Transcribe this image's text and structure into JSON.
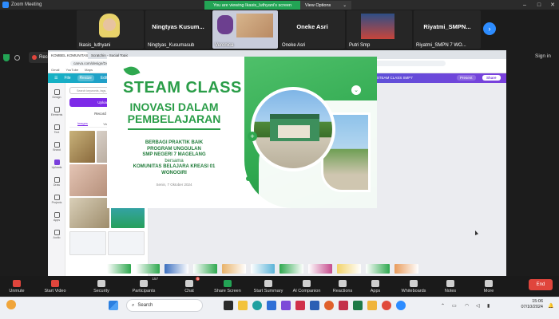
{
  "zoom": {
    "window_title": "Zoom Meeting",
    "banner_viewing": "You are viewing Ikasis_luthyani's screen",
    "banner_view_options": "View Options",
    "window_controls": [
      "–",
      "□",
      "✕"
    ]
  },
  "participants": [
    {
      "name": "Ikasis_luthyani",
      "type": "video"
    },
    {
      "name": "Ningtyas_Kusumasub",
      "title": "Ningtyas  Kusum...",
      "type": "name"
    },
    {
      "name": "Veronica",
      "type": "video"
    },
    {
      "name": "Oneke Asri",
      "title": "Oneke Asri",
      "type": "name"
    },
    {
      "name": "Putri Smp",
      "type": "video"
    },
    {
      "name": "Riyatmi_SMPN 7 WO...",
      "title": "Riyatmi_SMPN...",
      "type": "name"
    }
  ],
  "recording": {
    "label": "Recording...",
    "pause": "II",
    "stop": "■"
  },
  "sign_in": "Sign in",
  "browser": {
    "tabs": [
      "KOMBEL KOMUNITAS WDS...",
      "Scratchin - Social Topic"
    ],
    "url": "canva.com/design/DAGSbVHRV/Q4VMb7d9ZeJB-a6kx5d07Vb/edit",
    "bookmarks": [
      "Gmail",
      "YouTube",
      "Maps"
    ]
  },
  "canva": {
    "menu": [
      "File",
      "Resize",
      "Editing"
    ],
    "doc_title": "KOMBEL WORKSHOP STEAM CLASS SMP7",
    "present": "Present",
    "share": "Share",
    "rail": [
      "Design",
      "Elements",
      "Text",
      "Brand",
      "Uploads",
      "Draw",
      "Projects",
      "Apps",
      "Audio"
    ],
    "search_placeholder": "Search keywords, tags, color, and...",
    "upload_button": "Upload files",
    "record_yourself": "Record yourself",
    "upload_tabs": [
      "Images",
      "Videos",
      "Audio"
    ],
    "active_upload_tab": "Images"
  },
  "slide": {
    "title": "STEAM CLASS",
    "subtitle": "INOVASI DALAM PEMBELAJARAN",
    "body_lines": [
      "BERBAGI PRAKTIK BAIK",
      "PROGRAM UNGGULAN",
      "SMP NEGERI 7 MAGELANG",
      "bersama",
      "KOMUNITAS BELAJARA KREASI 01",
      "WONOGIRI"
    ],
    "date": "Senin, 7 Oktober 2024",
    "colors": {
      "accent": "#2fa84f",
      "dark": "#1f7a38"
    }
  },
  "toolbar": [
    {
      "label": "Unmute",
      "icon": "mic-muted-icon",
      "style": "red"
    },
    {
      "label": "Start Video",
      "icon": "video-off-icon",
      "style": "red"
    },
    {
      "label": "Security",
      "icon": "shield-icon"
    },
    {
      "label": "Participants",
      "icon": "participants-icon",
      "badge": "157"
    },
    {
      "label": "Chat",
      "icon": "chat-icon",
      "badge": "6"
    },
    {
      "label": "Share Screen",
      "icon": "share-screen-icon",
      "style": "green"
    },
    {
      "label": "Start Summary",
      "icon": "summary-icon"
    },
    {
      "label": "AI Companion",
      "icon": "ai-companion-icon"
    },
    {
      "label": "Reactions",
      "icon": "reactions-icon"
    },
    {
      "label": "Apps",
      "icon": "apps-icon"
    },
    {
      "label": "Whiteboards",
      "icon": "whiteboard-icon"
    },
    {
      "label": "Notes",
      "icon": "notes-icon"
    },
    {
      "label": "More",
      "icon": "more-icon"
    }
  ],
  "end_button": "End",
  "taskbar": {
    "search_placeholder": "Search",
    "time": "15:06",
    "date": "07/10/2024"
  }
}
